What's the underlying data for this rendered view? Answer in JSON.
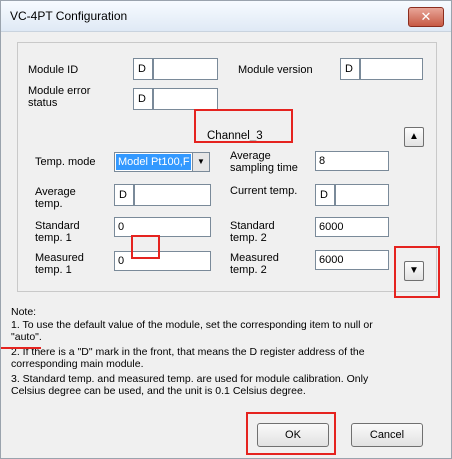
{
  "window": {
    "title": "VC-4PT Configuration",
    "close_glyph": "✕"
  },
  "module": {
    "id_label": "Module ID",
    "id_prefix": "D",
    "id_value": "",
    "version_label": "Module version",
    "version_prefix": "D",
    "version_value": "",
    "error_label_1": "Module error",
    "error_label_2": "status",
    "error_prefix": "D",
    "error_value": ""
  },
  "channel": {
    "label": "Channel_3",
    "up_glyph": "▲",
    "down_glyph": "▼"
  },
  "fields": {
    "temp_mode_label": "Temp. mode",
    "temp_mode_value": "Model Pt100,F",
    "temp_mode_arrow": "▼",
    "avg_sampling_label_1": "Average",
    "avg_sampling_label_2": "sampling time",
    "avg_sampling_value": "8",
    "avg_temp_label_1": "Average",
    "avg_temp_label_2": "temp.",
    "avg_temp_prefix": "D",
    "avg_temp_value": "",
    "current_temp_label": "Current temp.",
    "current_temp_prefix": "D",
    "current_temp_value": "",
    "std_temp1_label_1": "Standard",
    "std_temp1_label_2": "temp. 1",
    "std_temp1_value": "0",
    "std_temp2_label_1": "Standard",
    "std_temp2_label_2": "temp. 2",
    "std_temp2_value": "6000",
    "meas_temp1_label_1": "Measured",
    "meas_temp1_label_2": "temp. 1",
    "meas_temp1_value": "0",
    "meas_temp2_label_1": "Measured",
    "meas_temp2_label_2": "temp. 2",
    "meas_temp2_value": "6000"
  },
  "notes": {
    "heading": "Note:",
    "line1a": "1. To use the default value of the module, set the corresponding item to null or",
    "line1b": "\"auto\".",
    "line2a": "2. If there is a \"D\" mark in the front, that means the D register address of the",
    "line2b": "corresponding main module.",
    "line3a": "3. Standard temp. and measured temp. are used for module calibration. Only",
    "line3b": "Celsius degree can be used, and the unit is 0.1 Celsius degree."
  },
  "buttons": {
    "ok": "OK",
    "cancel": "Cancel"
  },
  "colors": {
    "highlight": "#e5231f",
    "selection": "#3399ff"
  }
}
